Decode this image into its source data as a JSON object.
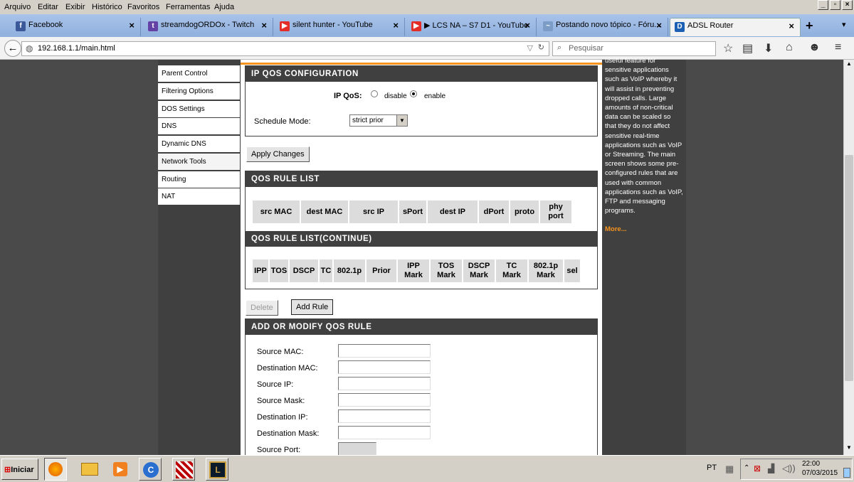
{
  "browser": {
    "menu": [
      "Arquivo",
      "Editar",
      "Exibir",
      "Histórico",
      "Favoritos",
      "Ferramentas",
      "Ajuda"
    ],
    "tabs": [
      {
        "title": "Facebook",
        "icon": "facebook-icon",
        "color": "#3b5998",
        "glyph": "f"
      },
      {
        "title": "streamdogORDOx - Twitch",
        "icon": "twitch-icon",
        "color": "#6441a5",
        "glyph": "t"
      },
      {
        "title": "silent hunter - YouTube",
        "icon": "youtube-icon",
        "color": "#e52d27",
        "glyph": "▶"
      },
      {
        "title": "▶ LCS NA – S7 D1 - YouTube",
        "icon": "youtube-icon",
        "color": "#e52d27",
        "glyph": "▶"
      },
      {
        "title": "Postando novo tópico - Fóru...",
        "icon": "forum-icon",
        "color": "#7a9cc6",
        "glyph": "~"
      },
      {
        "title": "ADSL Router",
        "icon": "dlink-icon",
        "color": "#1a5fb4",
        "glyph": "D"
      }
    ],
    "url": "192.168.1.1/main.html",
    "search_placeholder": "Pesquisar"
  },
  "sidebar": {
    "items": [
      "Parent Control",
      "Filtering Options",
      "DOS Settings",
      "DNS",
      "Dynamic DNS",
      "Network Tools",
      "Routing",
      "NAT"
    ],
    "active": "Network Tools"
  },
  "qos_config": {
    "header": "IP QOS CONFIGURATION",
    "ip_qos_label": "IP QoS:",
    "option_disable": "disable",
    "option_enable": "enable",
    "selected": "enable",
    "schedule_label": "Schedule Mode:",
    "schedule_value": "strict prior"
  },
  "apply_button": "Apply Changes",
  "rule_list": {
    "header": "QOS RULE LIST",
    "columns": [
      "src MAC",
      "dest MAC",
      "src IP",
      "sPort",
      "dest IP",
      "dPort",
      "proto",
      "phy port"
    ]
  },
  "rule_list_cont": {
    "header": "QOS RULE LIST(CONTINUE)",
    "columns": [
      "IPP",
      "TOS",
      "DSCP",
      "TC",
      "802.1p",
      "Prior",
      "IPP Mark",
      "TOS Mark",
      "DSCP Mark",
      "TC Mark",
      "802.1p Mark",
      "sel"
    ]
  },
  "delete_button": "Delete",
  "add_rule_button": "Add Rule",
  "modify_rule": {
    "header": "ADD OR MODIFY QOS RULE",
    "fields": [
      "Source MAC:",
      "Destination MAC:",
      "Source IP:",
      "Source Mask:",
      "Destination IP:",
      "Destination Mask:",
      "Source Port:"
    ]
  },
  "help": {
    "text": "useful feature for sensitive applications such as VoIP whereby it will assist in preventing dropped calls. Large amounts of non-critical data can be scaled so that they do not affect sensitive real-time applications such as VoIP or Streaming. The main screen shows some pre-configured rules that are used with common applications such as VoIP, FTP and messaging programs.",
    "more": "More..."
  },
  "taskbar": {
    "start": "Iniciar",
    "lang": "PT",
    "time": "22:00",
    "date": "07/03/2015"
  },
  "colors": {
    "accent": "#404040",
    "more_link": "#f7941d",
    "tab_bar": "#9db9e3"
  }
}
